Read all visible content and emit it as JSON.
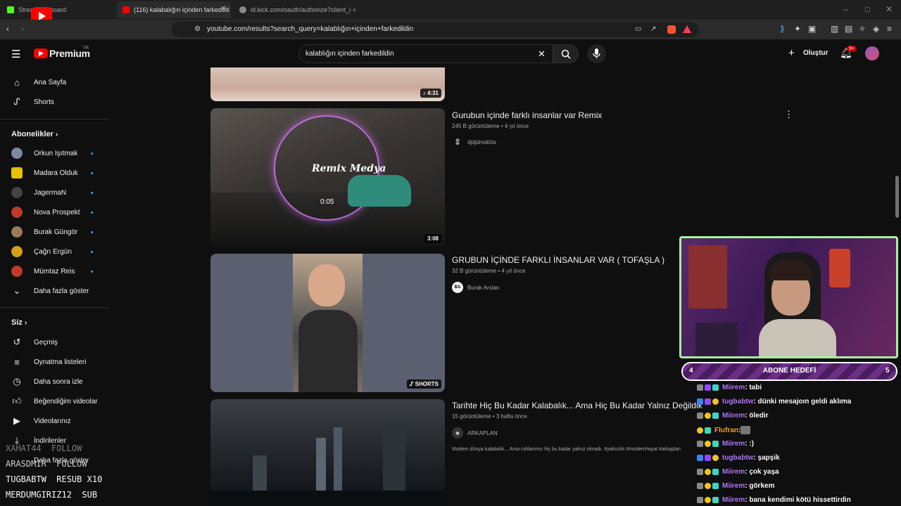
{
  "browser": {
    "tabs": [
      {
        "label": "Strea  Dashboard",
        "active": false
      },
      {
        "label": "(116) kalabalığın içinden farkedildi",
        "active": true
      },
      {
        "label": "id.kick.com/oauth/authorize?client_i...",
        "active": false
      }
    ],
    "url": "youtube.com/results?search_query=kalablığın+içinden+farkedildin"
  },
  "header": {
    "logo": "Premium",
    "logo_sup": "TR",
    "search_value": "kalablığın içinden farkedildin",
    "create_label": "Oluştur",
    "notif_count": "9+"
  },
  "sidebar": {
    "home": "Ana Sayfa",
    "shorts": "Shorts",
    "subs_title": "Abonelikler",
    "subs": [
      {
        "label": "Orkun Işıtmak",
        "color": "#7a8aa0"
      },
      {
        "label": "Madara Olduk",
        "color": "#e5c200"
      },
      {
        "label": "JagermaN",
        "color": "#444444"
      },
      {
        "label": "Nova Prospekt",
        "color": "#c0392b"
      },
      {
        "label": "Burak Güngör",
        "color": "#9b7b5b"
      },
      {
        "label": "Çağrı Ergün",
        "color": "#d4a017"
      },
      {
        "label": "Mümtaz Reis",
        "color": "#c0392b"
      }
    ],
    "show_more": "Daha fazla göster",
    "you_title": "Siz",
    "you_items": [
      "Geçmiş",
      "Oynatma listeleri",
      "Daha sonra izle",
      "Beğendiğim videolar",
      "Videolarınız",
      "İndirilenler"
    ],
    "show_more2": "Daha fazla göster"
  },
  "results": [
    {
      "duration": "4:31"
    },
    {
      "title": "Gurubun içinde farklı insanlar var Remix",
      "meta": "245 B görüntüleme • 4 yıl önce",
      "channel": "djdjdmdöös",
      "duration": "3:08",
      "overlay_time": "0:05",
      "overlay_text": "Remix Medya"
    },
    {
      "title": "GRUBUN İÇİNDE FARKLI İNSANLAR VAR ( TOFAŞLA )",
      "meta": "32 B görüntüleme • 4 yıl önce",
      "channel": "Burak Arslan",
      "channel_initials": "BA",
      "badge": "SHORTS"
    },
    {
      "title": "Tarihte Hiç Bu Kadar Kalabalık... Ama Hiç Bu Kadar Yalnız Değildik",
      "meta": "15 görüntüleme • 3 hafta önce",
      "channel": "ARKAPLAN",
      "desc": "Modern dünya kalabalık... Ama ruhlarımız hiç bu kadar yalnız olmadı. #yalnızlık #modernhayat #arkaplan"
    }
  ],
  "goal": {
    "left": "4",
    "label": "ABONE HEDEFİ",
    "right": "5"
  },
  "chat": [
    {
      "user": "Miirem",
      "msg": ": tabi",
      "color": "#b57bff"
    },
    {
      "user": "tugbabtw",
      "msg": ": dünki mesajoın geldi aklıma",
      "color": "#b57bff"
    },
    {
      "user": "Miirem",
      "msg": ": öledir",
      "color": "#b57bff"
    },
    {
      "user": "Flufran",
      "msg": ": ",
      "color": "#f0a830"
    },
    {
      "user": "Miirem",
      "msg": ": :)",
      "color": "#b57bff"
    },
    {
      "user": "tugbabtw",
      "msg": ": şapşik",
      "color": "#b57bff"
    },
    {
      "user": "Miirem",
      "msg": ": çok yaşa",
      "color": "#b57bff"
    },
    {
      "user": "Miirem",
      "msg": ": görkem",
      "color": "#b57bff"
    },
    {
      "user": "Miirem",
      "msg": ": bana kendimi kötü hissettirdin",
      "color": "#b57bff"
    }
  ],
  "alerts": [
    "XAHAT44  FOLLOW",
    "ARASDMIR  FOLLOW",
    "TUGBABTW  RESUB X10",
    "MERDUMGIRIZ12  SUB"
  ]
}
